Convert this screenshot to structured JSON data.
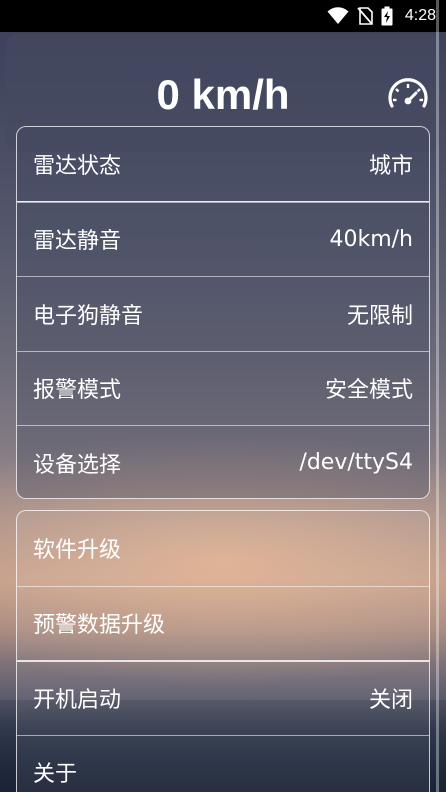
{
  "status_bar": {
    "time": "4:28",
    "icons": [
      "wifi-icon",
      "no-sim-icon",
      "battery-charging-icon"
    ]
  },
  "header": {
    "speed": "0 km/h",
    "icon": "speedometer-icon"
  },
  "settings_group_1": [
    {
      "label": "雷达状态",
      "value": "城市"
    },
    {
      "label": "雷达静音",
      "value": "40km/h"
    },
    {
      "label": "电子狗静音",
      "value": "无限制"
    },
    {
      "label": "报警模式",
      "value": "安全模式"
    },
    {
      "label": "设备选择",
      "value": "/dev/ttyS4"
    }
  ],
  "settings_group_2": [
    {
      "label": "软件升级",
      "value": ""
    },
    {
      "label": "预警数据升级",
      "value": ""
    },
    {
      "label": "开机启动",
      "value": "关闭"
    },
    {
      "label": "关于",
      "value": ""
    }
  ]
}
